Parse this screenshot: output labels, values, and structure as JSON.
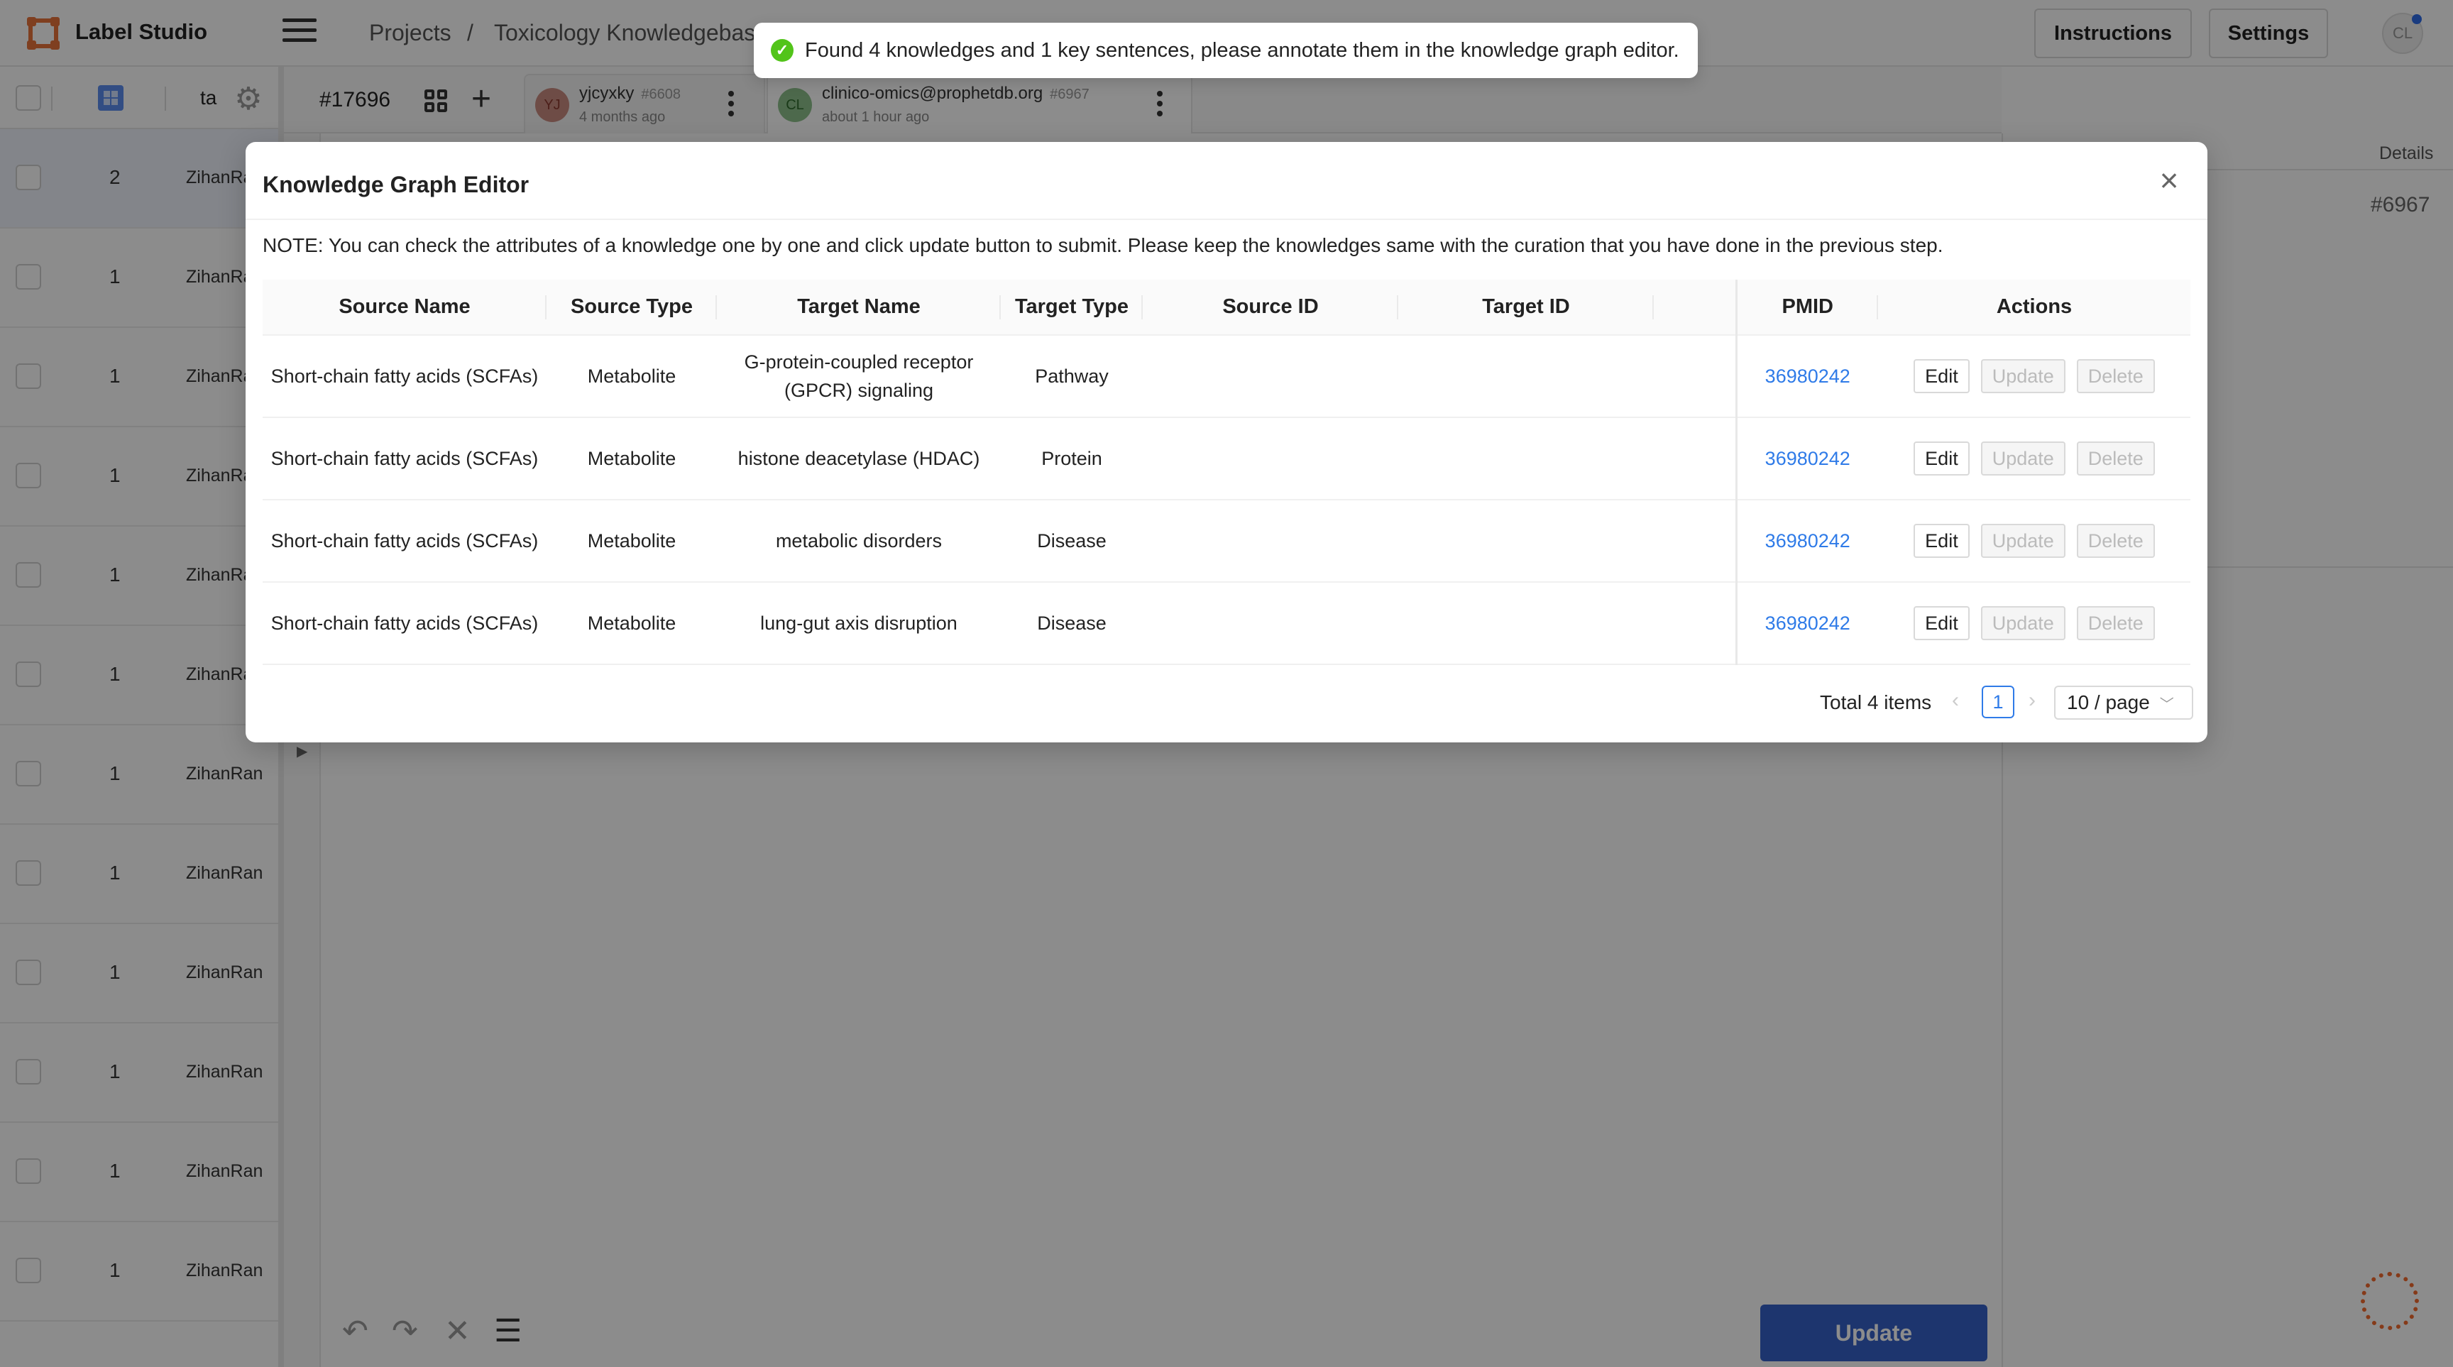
{
  "app": {
    "title": "Label Studio",
    "breadcrumb": [
      "Projects",
      "/",
      "Toxicology Knowledgebas"
    ]
  },
  "header": {
    "instructions_label": "Instructions",
    "settings_label": "Settings",
    "user_initials": "CL"
  },
  "data_table": {
    "column_partial": "ta",
    "rows": [
      {
        "count": "2",
        "user": "ZihanRan"
      },
      {
        "count": "1",
        "user": "ZihanRan"
      },
      {
        "count": "1",
        "user": "ZihanRan"
      },
      {
        "count": "1",
        "user": "ZihanRan"
      },
      {
        "count": "1",
        "user": "ZihanRan"
      },
      {
        "count": "1",
        "user": "ZihanRan"
      },
      {
        "count": "1",
        "user": "ZihanRan"
      },
      {
        "count": "1",
        "user": "ZihanRan"
      },
      {
        "count": "1",
        "user": "ZihanRan"
      },
      {
        "count": "1",
        "user": "ZihanRan"
      },
      {
        "count": "1",
        "user": "ZihanRan"
      },
      {
        "count": "1",
        "user": "ZihanRan"
      }
    ]
  },
  "annotation_bar": {
    "task_id": "#17696",
    "tabs": [
      {
        "initials": "YJ",
        "name": "yjcyxky",
        "number": "#6608",
        "time": "4 months ago",
        "color": "#c98a80"
      },
      {
        "initials": "CL",
        "name": "clinico-omics@prophetdb.org",
        "number": "#6967",
        "time": "about 1 hour ago",
        "color": "#8cc08a"
      }
    ]
  },
  "details_panel": {
    "label": "Details",
    "annotation_id": "#6967"
  },
  "bottom_toolbar": {
    "update_label": "Update"
  },
  "toast": {
    "message": "Found 4 knowledges and 1 key sentences, please annotate them in the knowledge graph editor."
  },
  "modal": {
    "title": "Knowledge Graph Editor",
    "note": "NOTE: You can check the attributes of a knowledge one by one and click update button to submit. Please keep the knowledges same with the curation that you have done in the previous step.",
    "columns": [
      "Source Name",
      "Source Type",
      "Target Name",
      "Target Type",
      "Source ID",
      "Target ID",
      "",
      "PMID",
      "Actions"
    ],
    "rows": [
      {
        "source_name": "Short-chain fatty acids (SCFAs)",
        "source_type": "Metabolite",
        "target_name": "G-protein-coupled receptor (GPCR) signaling",
        "target_type": "Pathway",
        "source_id": "",
        "target_id": "",
        "pmid": "36980242"
      },
      {
        "source_name": "Short-chain fatty acids (SCFAs)",
        "source_type": "Metabolite",
        "target_name": "histone deacetylase (HDAC)",
        "target_type": "Protein",
        "source_id": "",
        "target_id": "",
        "pmid": "36980242"
      },
      {
        "source_name": "Short-chain fatty acids (SCFAs)",
        "source_type": "Metabolite",
        "target_name": "metabolic disorders",
        "target_type": "Disease",
        "source_id": "",
        "target_id": "",
        "pmid": "36980242"
      },
      {
        "source_name": "Short-chain fatty acids (SCFAs)",
        "source_type": "Metabolite",
        "target_name": "lung-gut axis disruption",
        "target_type": "Disease",
        "source_id": "",
        "target_id": "",
        "pmid": "36980242"
      }
    ],
    "actions": {
      "edit": "Edit",
      "update": "Update",
      "delete": "Delete"
    },
    "pagination": {
      "total": "Total 4 items",
      "current_page": "1",
      "page_size": "10 / page"
    }
  }
}
